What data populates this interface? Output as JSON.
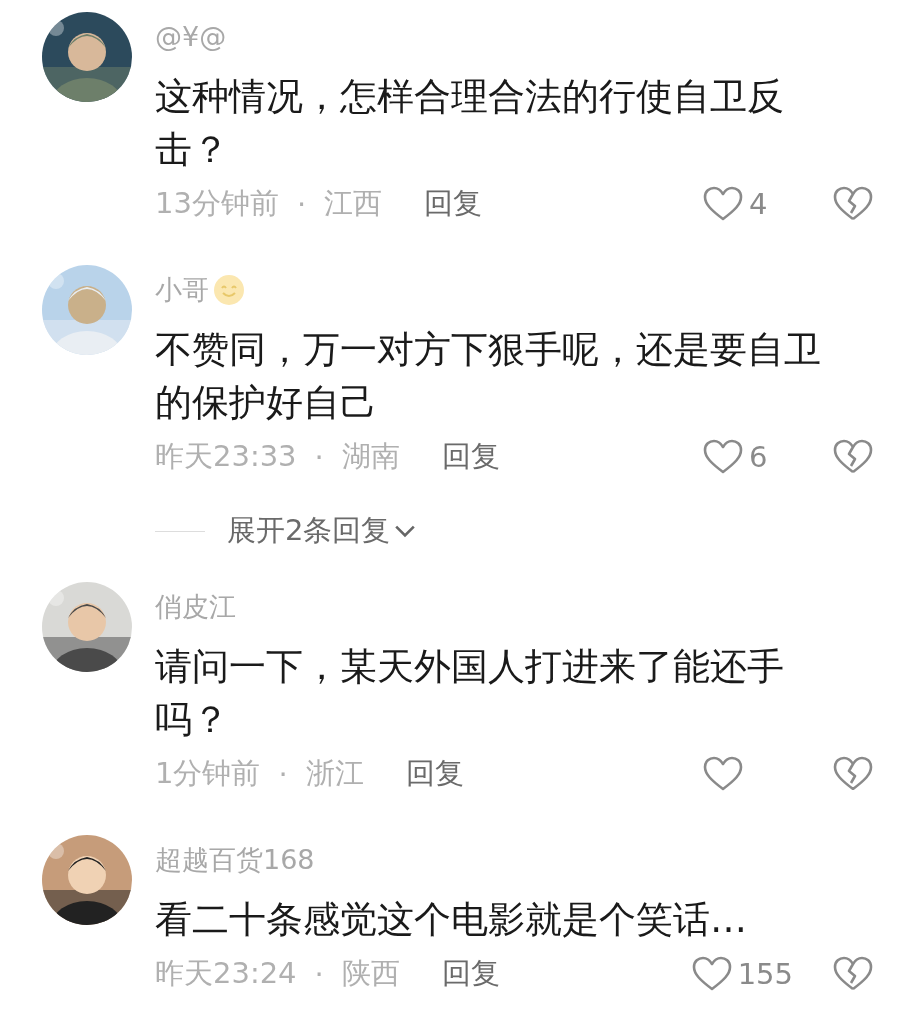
{
  "items": [
    {
      "kind": "comment",
      "name": "@¥@",
      "text": "这种情况，怎样合理合法的行使自卫反击？",
      "time": "13分钟前",
      "separator": "·",
      "location": "江西",
      "reply": "回复",
      "likes": "4"
    },
    {
      "kind": "comment",
      "name": "小哥",
      "name_emoji": true,
      "text": "不赞同，万一对方下狠手呢，还是要自卫的保护好自己",
      "time": "昨天23:33",
      "separator": "·",
      "location": "湖南",
      "reply": "回复",
      "likes": "6"
    },
    {
      "kind": "expand",
      "label": "展开2条回复"
    },
    {
      "kind": "comment",
      "name": "俏皮江",
      "text": "请问一下，某天外国人打进来了能还手吗？",
      "time": "1分钟前",
      "separator": "·",
      "location": "浙江",
      "reply": "回复"
    },
    {
      "kind": "comment",
      "name": "超越百货168",
      "text": "看二十条感觉这个电影就是个笑话…",
      "time": "昨天23:24",
      "separator": "·",
      "location": "陕西",
      "reply": "回复",
      "likes": "155"
    }
  ]
}
